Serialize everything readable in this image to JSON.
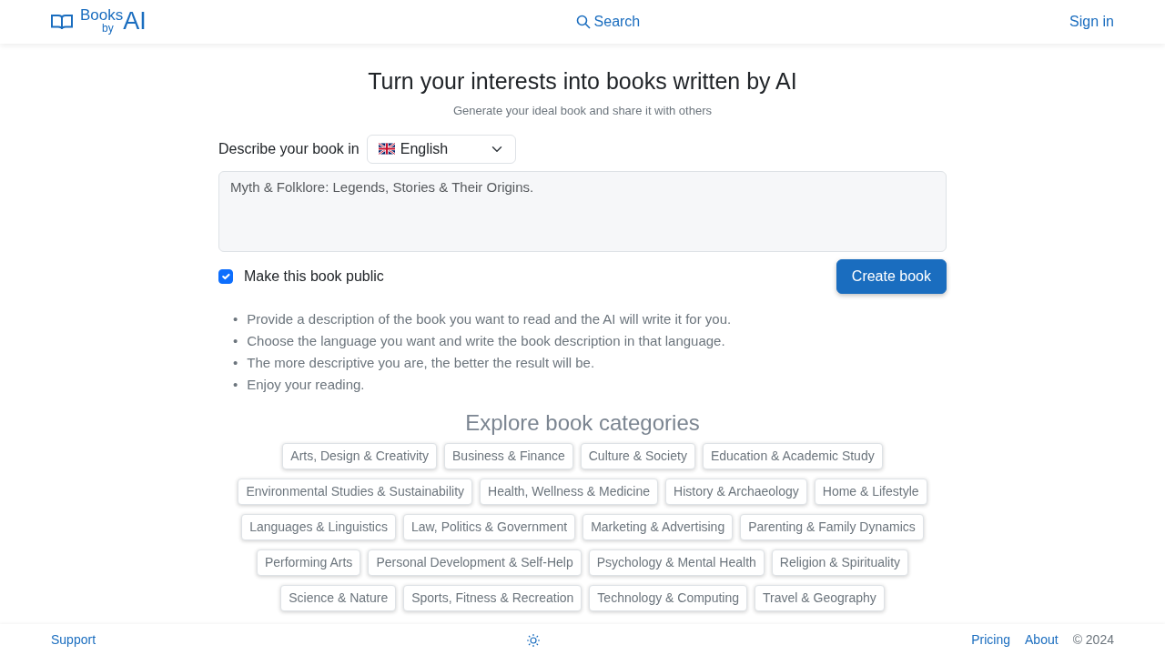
{
  "header": {
    "logo_top": "Books",
    "logo_by": "by",
    "logo_ai": "AI",
    "search": "Search",
    "sign_in": "Sign in"
  },
  "hero": {
    "title": "Turn your interests into books written by AI",
    "subtitle": "Generate your ideal book and share it with others"
  },
  "form": {
    "language_label": "Describe your book in",
    "language": "English",
    "placeholder": "Myth & Folklore: Legends, Stories & Their Origins.",
    "public_label": "Make this book public",
    "public_checked": true,
    "create_button": "Create book"
  },
  "tips": [
    {
      "bullet": "•",
      "text": "Provide a description of the book you want to read and the AI will write it for you."
    },
    {
      "bullet": "•",
      "text": "Choose the language you want and write the book description in that language."
    },
    {
      "bullet": "•",
      "text": "The more descriptive you are, the better the result will be."
    },
    {
      "bullet": "•",
      "text": "Enjoy your reading."
    }
  ],
  "categories_title": "Explore book categories",
  "categories": [
    [
      "Arts, Design & Creativity",
      "Business & Finance",
      "Culture & Society",
      "Education & Academic Study"
    ],
    [
      "Environmental Studies & Sustainability",
      "Health, Wellness & Medicine",
      "History & Archaeology",
      "Home & Lifestyle"
    ],
    [
      "Languages & Linguistics",
      "Law, Politics & Government",
      "Marketing & Advertising",
      "Parenting & Family Dynamics"
    ],
    [
      "Performing Arts",
      "Personal Development & Self-Help",
      "Psychology & Mental Health",
      "Religion & Spirituality"
    ],
    [
      "Science & Nature",
      "Sports, Fitness & Recreation",
      "Technology & Computing",
      "Travel & Geography"
    ]
  ],
  "footer": {
    "support": "Support",
    "pricing": "Pricing",
    "about": "About",
    "copyright": "© 2024"
  }
}
